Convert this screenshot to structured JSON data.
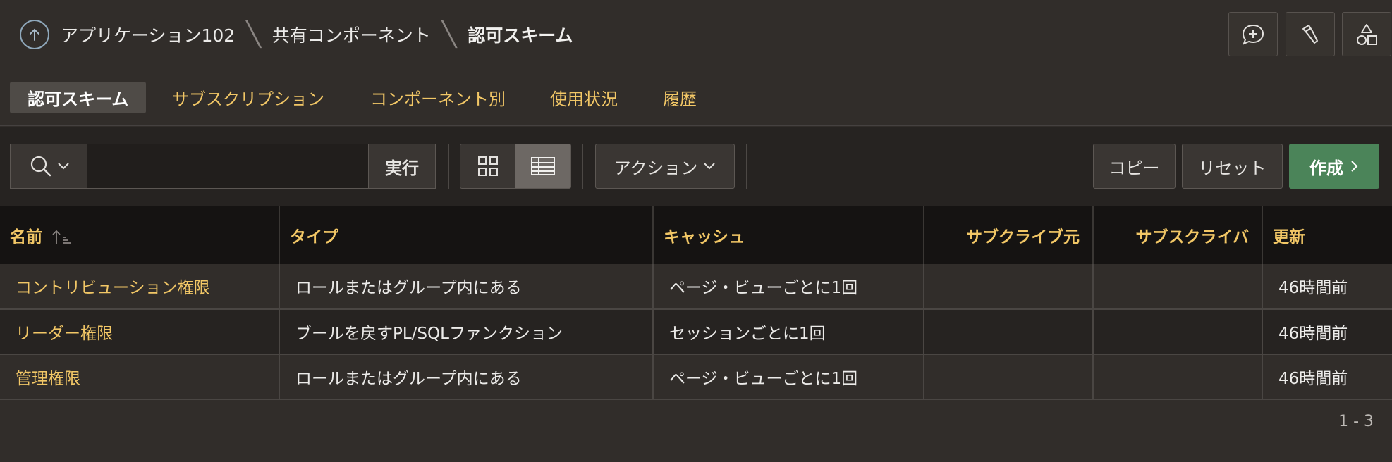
{
  "breadcrumb": {
    "items": [
      "アプリケーション102",
      "共有コンポーネント"
    ],
    "current": "認可スキーム"
  },
  "header_actions": [
    "comment-icon",
    "flashlight-icon",
    "shapes-icon"
  ],
  "tabs": [
    {
      "label": "認可スキーム",
      "active": true
    },
    {
      "label": "サブスクリプション",
      "active": false
    },
    {
      "label": "コンポーネント別",
      "active": false
    },
    {
      "label": "使用状況",
      "active": false
    },
    {
      "label": "履歴",
      "active": false
    }
  ],
  "toolbar": {
    "search_value": "",
    "go_label": "実行",
    "actions_label": "アクション",
    "copy_label": "コピー",
    "reset_label": "リセット",
    "create_label": "作成"
  },
  "table": {
    "columns": [
      "名前",
      "タイプ",
      "キャッシュ",
      "サブクライブ元",
      "サブスクライバ",
      "更新"
    ],
    "rows": [
      [
        "コントリビューション権限",
        "ロールまたはグループ内にある",
        "ページ・ビューごとに1回",
        "",
        "",
        "46時間前"
      ],
      [
        "リーダー権限",
        "ブールを戻すPL/SQLファンクション",
        "セッションごとに1回",
        "",
        "",
        "46時間前"
      ],
      [
        "管理権限",
        "ロールまたはグループ内にある",
        "ページ・ビューごとに1回",
        "",
        "",
        "46時間前"
      ]
    ]
  },
  "pagination": "1 - 3",
  "colors": {
    "background": "#312d2a",
    "link": "#f2c766",
    "create_button": "#4b8459"
  }
}
